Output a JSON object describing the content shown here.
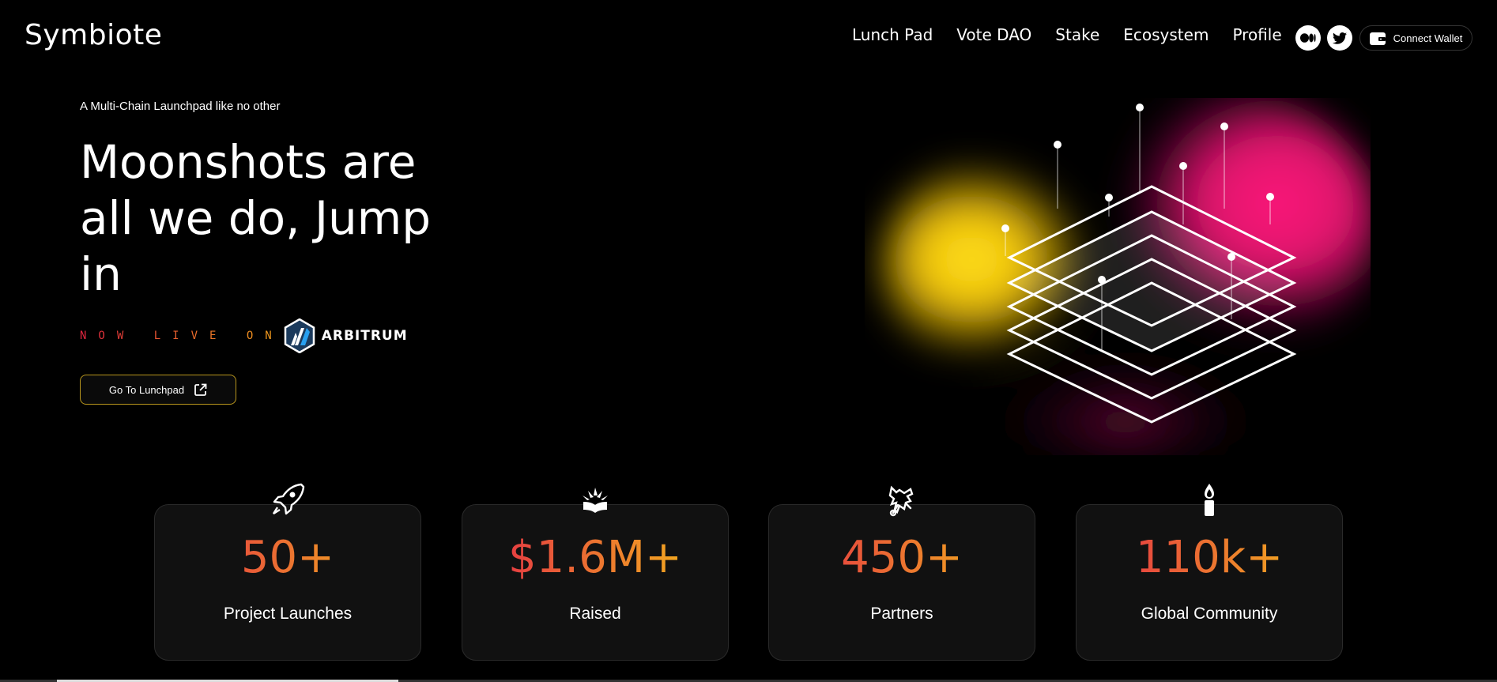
{
  "brand": {
    "name": "Symbiote"
  },
  "nav": {
    "items": [
      "Lunch Pad",
      "Vote DAO",
      "Stake",
      "Ecosystem",
      "Profile"
    ]
  },
  "social": {
    "icons": [
      "medium-icon",
      "twitter-icon"
    ]
  },
  "wallet": {
    "label": "Connect Wallet",
    "icon": "wallet-icon"
  },
  "hero": {
    "tagline": "A Multi-Chain Launchpad like no other",
    "headline": "Moonshots are all we do, Jump in",
    "live_label": "NOW LIVE ON",
    "chain_name": "ARBITRUM",
    "cta_label": "Go To Lunchpad",
    "cta_icon": "external-link-icon"
  },
  "stats": [
    {
      "value": "50+",
      "label": "Project Launches",
      "icon": "rocket-icon"
    },
    {
      "value": "$1.6M+",
      "label": "Raised",
      "icon": "open-book-icon"
    },
    {
      "value": "450+",
      "label": "Partners",
      "icon": "dragon-icon"
    },
    {
      "value": "110k+",
      "label": "Global Community",
      "icon": "candle-icon"
    }
  ],
  "colors": {
    "gradient_start": "#e3244a",
    "gradient_end": "#f5c217",
    "cta_border": "#b8961d",
    "background": "#000000"
  }
}
